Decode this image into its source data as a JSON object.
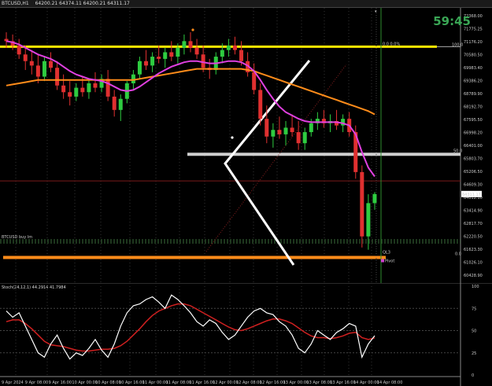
{
  "window": {
    "symbol": "BTCUSD,H1",
    "ohlc": "64200.21 64374.11 64200.21 64311.17"
  },
  "timer": "59:45",
  "overlay_labels": {
    "delta": "0.0 0.0%",
    "fib_top": "100.0",
    "fib_mid": "50.0",
    "fib_bot": "0.0",
    "ql3": "QL3",
    "pivot": "Pivot",
    "left_cluster": "BTCUSD buy lm"
  },
  "osc_title": "Stoch(24,12,1) 44.2914 41.7984",
  "colors": {
    "bull": "#2ecc40",
    "bear": "#e03030",
    "ma_magenta": "#e040e0",
    "ma_orange": "#ff8c1a",
    "yellow_line": "#ffe600",
    "gray_line": "#cfcfcf",
    "orange_line": "#ff8c1a",
    "green_vline": "#2e8b2e",
    "stoch_main": "#ffffff",
    "stoch_signal": "#d02020",
    "timer": "#3aa655"
  },
  "chart_data": [
    {
      "type": "candlestick",
      "title": "BTCUSD,H1",
      "y_ticks": [
        "72368.00",
        "71775.25",
        "71176.20",
        "70580.50",
        "69983.40",
        "69386.20",
        "68789.90",
        "68192.70",
        "67595.50",
        "66998.20",
        "66401.00",
        "65803.70",
        "65206.50",
        "64609.30",
        "64012.10",
        "63414.90",
        "62817.70",
        "62220.50",
        "61623.30",
        "61026.10",
        "60428.90"
      ],
      "current_price": "64311.17",
      "x_ticks": [
        "9 Apr 2024",
        "9 Apr 08:00",
        "9 Apr 16:00",
        "10 Apr 00:00",
        "10 Apr 08:00",
        "10 Apr 16:00",
        "11 Apr 00:00",
        "11 Apr 08:00",
        "11 Apr 16:00",
        "12 Apr 00:00",
        "12 Apr 08:00",
        "12 Apr 16:00",
        "13 Apr 00:00",
        "13 Apr 08:00",
        "13 Apr 16:00",
        "14 Apr 00:00",
        "14 Apr 08:00"
      ],
      "ylim": [
        60300,
        72700
      ],
      "candles": [
        [
          71300,
          71600,
          70900,
          71200
        ],
        [
          71200,
          71500,
          70800,
          71000
        ],
        [
          71000,
          71300,
          70400,
          70600
        ],
        [
          70600,
          71000,
          69900,
          70300
        ],
        [
          70300,
          70800,
          69700,
          70100
        ],
        [
          70100,
          70600,
          69300,
          69600
        ],
        [
          69600,
          70500,
          69400,
          70300
        ],
        [
          70300,
          70700,
          69800,
          70000
        ],
        [
          70000,
          70300,
          69000,
          69200
        ],
        [
          69200,
          69700,
          68600,
          68900
        ],
        [
          68900,
          69400,
          68300,
          68700
        ],
        [
          68700,
          69300,
          68500,
          69100
        ],
        [
          69100,
          69600,
          68700,
          68900
        ],
        [
          68900,
          69500,
          68600,
          69300
        ],
        [
          69300,
          69800,
          68900,
          69100
        ],
        [
          69100,
          69700,
          68900,
          69500
        ],
        [
          69500,
          69900,
          68500,
          68700
        ],
        [
          68700,
          69000,
          67800,
          68100
        ],
        [
          68100,
          68800,
          67600,
          68600
        ],
        [
          68600,
          69400,
          68400,
          69300
        ],
        [
          69300,
          69900,
          69000,
          69700
        ],
        [
          69700,
          70500,
          69500,
          70300
        ],
        [
          70300,
          70800,
          69900,
          70100
        ],
        [
          70100,
          70700,
          69800,
          70500
        ],
        [
          70500,
          71000,
          70200,
          70400
        ],
        [
          70400,
          70900,
          70000,
          70700
        ],
        [
          70700,
          71200,
          70300,
          70500
        ],
        [
          70500,
          71100,
          70200,
          70900
        ],
        [
          70900,
          71500,
          70600,
          71200
        ],
        [
          71200,
          71600,
          70700,
          70900
        ],
        [
          70900,
          71300,
          70400,
          70600
        ],
        [
          70600,
          71000,
          69800,
          70000
        ],
        [
          70000,
          70400,
          69500,
          69900
        ],
        [
          69900,
          70700,
          69700,
          70500
        ],
        [
          70500,
          71100,
          70200,
          70800
        ],
        [
          70800,
          71300,
          70500,
          71000
        ],
        [
          71000,
          71400,
          70600,
          70800
        ],
        [
          70800,
          71200,
          70100,
          70300
        ],
        [
          70300,
          70700,
          69600,
          69800
        ],
        [
          69800,
          70200,
          68800,
          69000
        ],
        [
          69000,
          69300,
          67400,
          67700
        ],
        [
          67700,
          68300,
          66600,
          66900
        ],
        [
          66900,
          67500,
          66400,
          67200
        ],
        [
          67200,
          67800,
          66800,
          67000
        ],
        [
          67000,
          67600,
          66500,
          67300
        ],
        [
          67300,
          67900,
          66900,
          67100
        ],
        [
          67100,
          67600,
          66300,
          66600
        ],
        [
          66600,
          67300,
          66300,
          67100
        ],
        [
          67100,
          67700,
          66900,
          67500
        ],
        [
          67500,
          68000,
          67200,
          67700
        ],
        [
          67700,
          68100,
          67300,
          67500
        ],
        [
          67500,
          67900,
          67100,
          67600
        ],
        [
          67600,
          68100,
          67200,
          67400
        ],
        [
          67400,
          67900,
          67100,
          67700
        ],
        [
          67700,
          68000,
          66900,
          67100
        ],
        [
          67100,
          67400,
          65000,
          65300
        ],
        [
          65300,
          65600,
          61900,
          62400
        ],
        [
          62400,
          64300,
          61800,
          63900
        ],
        [
          63900,
          64400,
          63600,
          64311
        ]
      ],
      "series": [
        {
          "name": "MA fast",
          "values": [
            71200,
            71150,
            71050,
            70900,
            70750,
            70600,
            70500,
            70400,
            70250,
            70050,
            69850,
            69700,
            69600,
            69500,
            69450,
            69400,
            69300,
            69150,
            69000,
            68950,
            69000,
            69150,
            69350,
            69550,
            69750,
            69900,
            70050,
            70150,
            70250,
            70300,
            70300,
            70250,
            70200,
            70200,
            70250,
            70300,
            70300,
            70250,
            70100,
            69850,
            69450,
            69000,
            68600,
            68250,
            68000,
            67850,
            67700,
            67600,
            67550,
            67550,
            67550,
            67550,
            67550,
            67500,
            67400,
            67000,
            66200,
            65500,
            65100
          ]
        },
        {
          "name": "MA slow",
          "values": [
            69200,
            69250,
            69300,
            69350,
            69400,
            69450,
            69450,
            69450,
            69450,
            69450,
            69450,
            69450,
            69450,
            69450,
            69450,
            69450,
            69450,
            69450,
            69450,
            69450,
            69450,
            69500,
            69550,
            69600,
            69650,
            69700,
            69750,
            69800,
            69850,
            69900,
            69950,
            69950,
            69950,
            69950,
            69950,
            69950,
            69950,
            69950,
            69900,
            69850,
            69750,
            69650,
            69550,
            69450,
            69350,
            69250,
            69150,
            69050,
            68950,
            68850,
            68750,
            68650,
            68550,
            68450,
            68350,
            68250,
            68150,
            68050,
            67900
          ]
        }
      ],
      "levels": {
        "yellow": 70950,
        "gray": 66100,
        "orange": 61450
      }
    },
    {
      "type": "line",
      "title": "Stoch(24,12,1) 44.2914 41.7984",
      "ylim": [
        0,
        100
      ],
      "y_ticks": [
        "100",
        "75",
        "50",
        "25",
        "0"
      ],
      "series": [
        {
          "name": "main",
          "values": [
            72,
            65,
            70,
            55,
            40,
            25,
            20,
            35,
            45,
            30,
            18,
            25,
            22,
            30,
            40,
            28,
            20,
            35,
            55,
            70,
            78,
            80,
            85,
            88,
            82,
            75,
            90,
            85,
            78,
            70,
            60,
            55,
            62,
            58,
            48,
            40,
            45,
            55,
            65,
            72,
            75,
            70,
            68,
            60,
            55,
            45,
            30,
            25,
            35,
            50,
            45,
            40,
            48,
            52,
            58,
            55,
            20,
            35,
            44.29
          ]
        },
        {
          "name": "signal",
          "values": [
            60,
            62,
            62,
            58,
            52,
            45,
            38,
            34,
            33,
            32,
            30,
            28,
            27,
            27,
            28,
            29,
            29,
            30,
            33,
            38,
            45,
            52,
            60,
            67,
            72,
            75,
            78,
            80,
            80,
            78,
            74,
            70,
            66,
            62,
            58,
            54,
            51,
            50,
            52,
            55,
            58,
            61,
            63,
            63,
            61,
            58,
            53,
            48,
            44,
            42,
            42,
            41,
            42,
            44,
            47,
            48,
            42,
            40,
            41.8
          ]
        }
      ]
    }
  ]
}
